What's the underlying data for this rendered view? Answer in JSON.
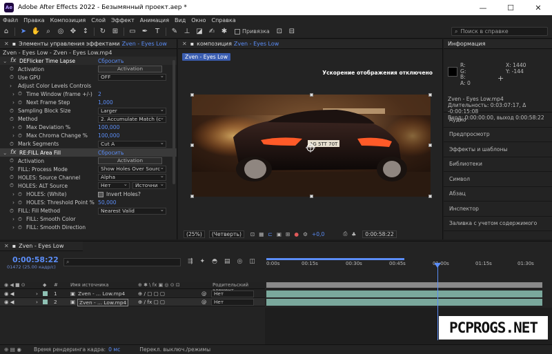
{
  "window": {
    "title": "Adobe After Effects 2022 - Безымянный проект.aep *",
    "logo_text": "Ae",
    "minimize": "—",
    "maximize": "☐",
    "close": "✕"
  },
  "menu": [
    "Файл",
    "Правка",
    "Композиция",
    "Слой",
    "Эффект",
    "Анимация",
    "Вид",
    "Окно",
    "Справка"
  ],
  "toolbar": {
    "snap_label": "Привязка",
    "search_help_placeholder": "Поиск в справке"
  },
  "effect_controls": {
    "tab_label": "Элементы управления эффектами",
    "tab_target": "Zven - Eyes Low",
    "header": "Zven - Eyes Low - Zven - Eyes Low.mp4",
    "reset_label": "Сбросить",
    "rows": [
      {
        "kind": "fx",
        "name": "DEFlicker Time Lapse",
        "value": "Сбросить"
      },
      {
        "kind": "button",
        "name": "Activation",
        "value": "Activation"
      },
      {
        "kind": "dropdown",
        "name": "Use GPU",
        "value": "OFF"
      },
      {
        "kind": "group",
        "name": "Adjust Color Levels Controls"
      },
      {
        "kind": "blue",
        "name": "Time Window (frame +/-)",
        "value": "2"
      },
      {
        "kind": "blue",
        "name": "Next Frame Step",
        "value": "1,000"
      },
      {
        "kind": "dropdown",
        "name": "Sampling Block Size",
        "value": "Larger"
      },
      {
        "kind": "dropdown",
        "name": "Method",
        "value": "2. Accumulate Match (c"
      },
      {
        "kind": "blue",
        "name": "Max Deviation %",
        "value": "100,000"
      },
      {
        "kind": "blue",
        "name": "Max Chroma Change %",
        "value": "100,000"
      },
      {
        "kind": "dropdown",
        "name": "Mark Segments",
        "value": "Cut A"
      },
      {
        "kind": "fx",
        "name": "RE:FILL Area Fill",
        "value": "Сбросить"
      },
      {
        "kind": "button",
        "name": "Activation",
        "value": "Activation"
      },
      {
        "kind": "dropdown",
        "name": "FILL: Process Mode",
        "value": "Show Holes Over Sourc"
      },
      {
        "kind": "dropdown",
        "name": "HOLES: Source Channel",
        "value": "Alpha"
      },
      {
        "kind": "dual",
        "name": "HOLES: ALT Source",
        "value": "Нет",
        "value2": "Источни"
      },
      {
        "kind": "check",
        "name": "HOLES: (White)",
        "value": "Invert Holes?"
      },
      {
        "kind": "blue",
        "name": "HOLES: Threshold Point %",
        "value": "50,000"
      },
      {
        "kind": "dropdown",
        "name": "FILL: Fill Method",
        "value": "Nearest Valid"
      },
      {
        "kind": "plain",
        "name": "FILL: Smooth Color"
      },
      {
        "kind": "plain",
        "name": "FILL: Smooth Direction"
      }
    ]
  },
  "composition": {
    "tab_label": "композиция",
    "tab_target": "Zven - Eyes Low",
    "sub_tab": "Zven - Eyes Low",
    "gpu_message": "Ускорение отображения отключено",
    "zoom": "(25%)",
    "resolution": "(Четверть)",
    "exposure": "+0,0",
    "timecode": "0:00:58:22",
    "plate_text": "AG 5TT 70T"
  },
  "info_panel": {
    "title": "Информация",
    "r": "R:",
    "g": "G:",
    "b": "B:",
    "a": "A: 0",
    "x": "X: 1440",
    "y": "Y: -144",
    "file": "Zven - Eyes Low.mp4",
    "duration": "Длительность: 0:03:07:17, Δ -0:00:15:08",
    "inout": "Вход: 0:00:00:00, выход 0:00:58:22"
  },
  "side_panels": [
    "Аудио",
    "Предпросмотр",
    "Эффекты и шаблоны",
    "Библиотеки",
    "Символ",
    "Абзац",
    "Инспектор",
    "Заливка с учетом содержимого"
  ],
  "timeline": {
    "tab_label": "Zven - Eyes Low",
    "time": "0:00:58:22",
    "frames": "01472 (25.00 кадр/с)",
    "search_placeholder": "⌕",
    "ruler_ticks": [
      "0:00s",
      "00:15s",
      "00:30s",
      "00:45s",
      "01:00s",
      "01:15s",
      "01:30s"
    ],
    "columns": {
      "num": "#",
      "source": "Имя источника",
      "parent": "Родительский элемент..."
    },
    "layers": [
      {
        "num": "1",
        "name": "Zven - ... Low.mp4",
        "parent": "Нет"
      },
      {
        "num": "2",
        "name": "Zven - ... Low.mp4",
        "parent": "Нет"
      }
    ]
  },
  "status": {
    "render_label": "Время рендеринга кадра:",
    "render_value": "0 мс",
    "toggle_label": "Перекл. выключ./режимы"
  },
  "watermark": "PCPROGS.NET"
}
